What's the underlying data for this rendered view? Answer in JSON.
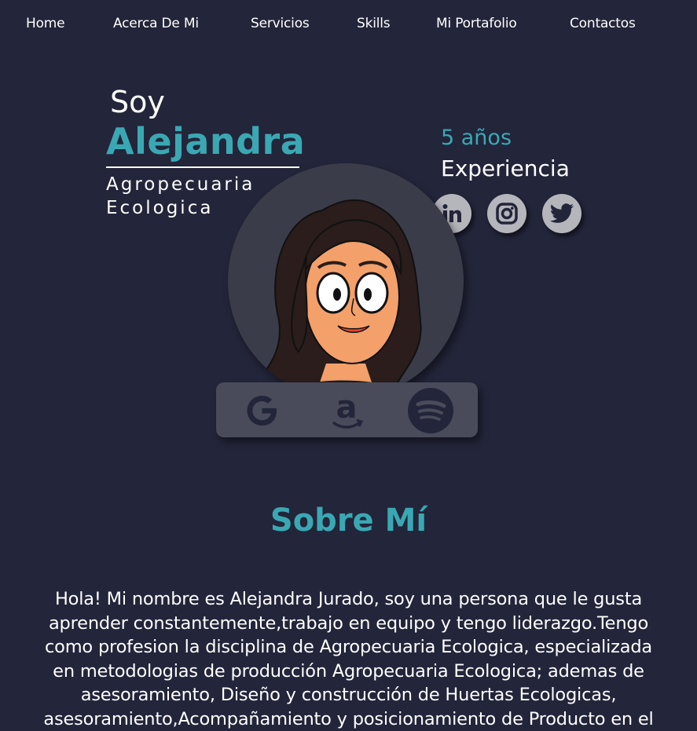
{
  "nav": {
    "items": [
      {
        "label": "Home"
      },
      {
        "label": "Acerca De Mi"
      },
      {
        "label": "Servicios"
      },
      {
        "label": "Skills"
      },
      {
        "label": "Mi Portafolio"
      },
      {
        "label": "Contactos"
      }
    ]
  },
  "hero": {
    "greeting": "Soy",
    "name": "Alejandra",
    "subtitle_line1": "Agropecuaria",
    "subtitle_line2": "Ecologica",
    "experience_years": "5 años",
    "experience_label": "Experiencia"
  },
  "social": [
    "linkedin-icon",
    "instagram-icon",
    "twitter-icon"
  ],
  "brands": [
    "google-icon",
    "amazon-icon",
    "spotify-icon"
  ],
  "colors": {
    "background": "#23253a",
    "accent": "#3aa8b3"
  },
  "about": {
    "title": "Sobre Mí",
    "lines": [
      "Hola! Mi nombre es Alejandra Jurado, soy una persona que le gusta",
      "aprender constantemente,trabajo en equipo y tengo liderazgo.Tengo",
      "como profesion la disciplina de Agropecuaria Ecologica, especializada",
      "en metodologias de producción Agropecuaria Ecologica; ademas de",
      "asesoramiento, Diseño y construcción de Huertas Ecologicas,",
      "asesoramiento,Acompañamiento y posicionamiento de Producto en el"
    ]
  }
}
